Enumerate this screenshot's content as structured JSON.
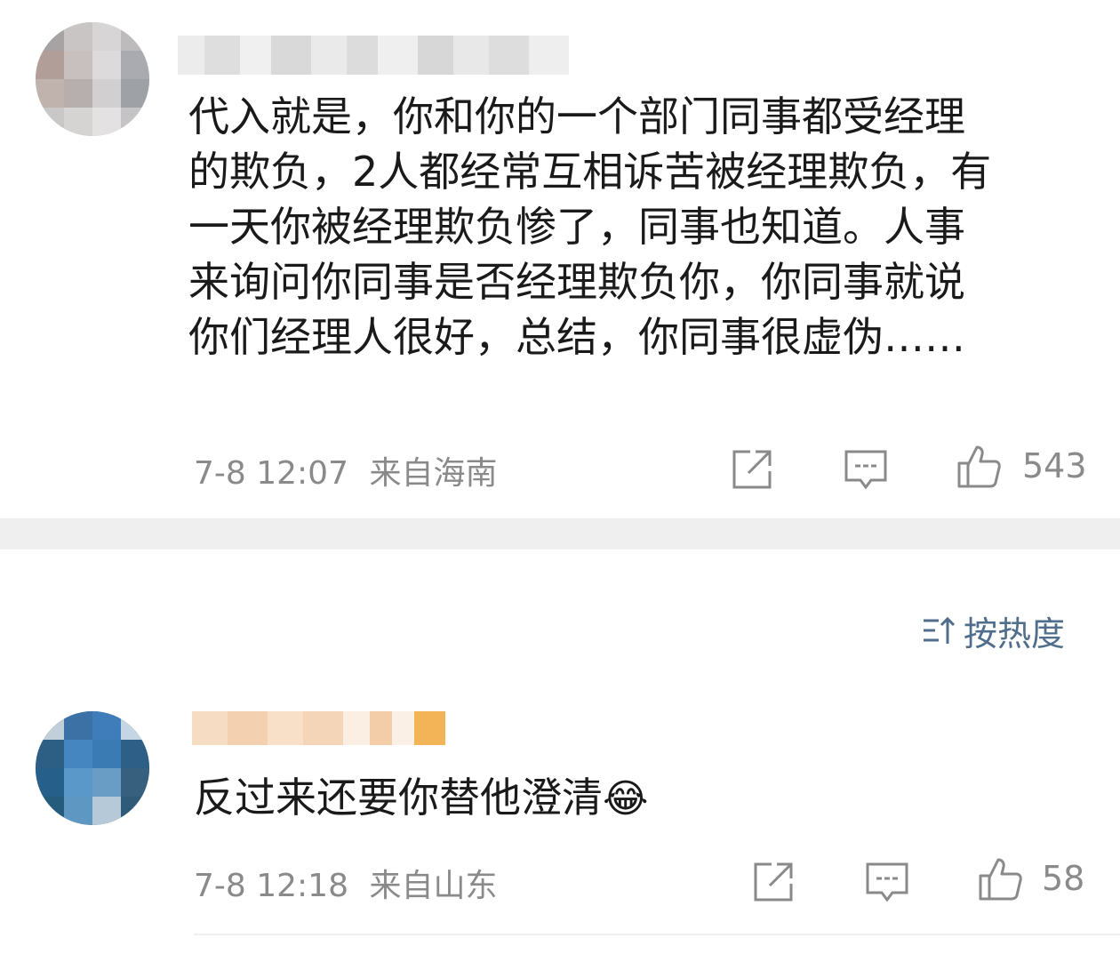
{
  "comments": [
    {
      "text": "代入就是，你和你的一个部门同事都受经理\n的欺负，2人都经常互相诉苦被经理欺负，有\n一天你被经理欺负惨了，同事也知道。人事\n来询问你同事是否经理欺负你，你同事就说\n你们经理人很好，总结，你同事很虚伪……",
      "time": "7-8 12:07",
      "location": "来自海南",
      "likes": "543"
    },
    {
      "text": "反过来还要你替他澄清",
      "emoji": "😂",
      "time": "7-8 12:18",
      "location": "来自山东",
      "likes": "58"
    }
  ],
  "sort": {
    "label": "按热度",
    "icon": "sort-icon"
  },
  "icons": [
    "share-icon",
    "comment-icon",
    "like-icon"
  ],
  "colors": {
    "meta": "#8a8a8a",
    "sort": "#506e8c",
    "divider": "#efefef"
  }
}
